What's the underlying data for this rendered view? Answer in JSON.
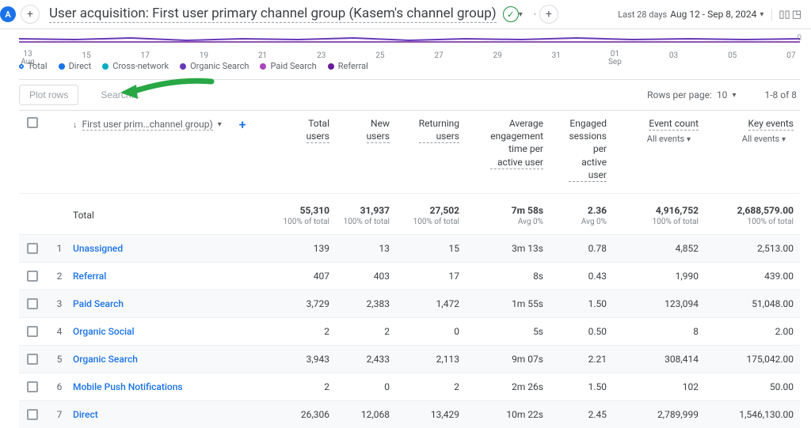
{
  "header": {
    "avatar_letter": "A",
    "add_button_glyph": "+",
    "title": "User acquisition: First user primary channel group (Kasem's channel group)",
    "check_glyph": "✓",
    "add_segment_glyph": "+",
    "date_label": "Last 28 days",
    "date_range": "Aug 12 - Sep 8, 2024"
  },
  "chart_data": {
    "type": "line",
    "ticks": [
      "13",
      "15",
      "17",
      "19",
      "21",
      "23",
      "25",
      "27",
      "29",
      "31",
      "01",
      "03",
      "05",
      "07"
    ],
    "tick_months": {
      "0": "Aug",
      "10": "Sep"
    },
    "ylim": [
      0,
      1000
    ],
    "y_zero_label": "0",
    "series": [
      {
        "name": "Total",
        "color": "#1a73e8",
        "open": true
      },
      {
        "name": "Direct",
        "color": "#1a73e8"
      },
      {
        "name": "Cross-network",
        "color": "#00acc1"
      },
      {
        "name": "Organic Search",
        "color": "#673ab7"
      },
      {
        "name": "Paid Search",
        "color": "#ab47bc"
      },
      {
        "name": "Referral",
        "color": "#6a1b9a"
      }
    ]
  },
  "toolbar": {
    "plot_rows": "Plot rows",
    "search_placeholder": "Search…",
    "rows_per_page_label": "Rows per page:",
    "rows_per_page_value": "10",
    "range_text": "1-8 of 8"
  },
  "columns": {
    "dimension": "First user prim…channel group)",
    "metrics": [
      {
        "label": "Total\nusers"
      },
      {
        "label": "New\nusers"
      },
      {
        "label": "Returning\nusers"
      },
      {
        "label": "Average\nengagement\ntime per\nactive user"
      },
      {
        "label": "Engaged\nsessions\nper\nactive\nuser"
      },
      {
        "label": "Event count",
        "sub": "All events"
      },
      {
        "label": "Key events",
        "sub": "All events"
      }
    ]
  },
  "totals": {
    "label": "Total",
    "values": [
      "55,310",
      "31,937",
      "27,502",
      "7m 58s",
      "2.36",
      "4,916,752",
      "2,688,579.00"
    ],
    "subs": [
      "100% of total",
      "100% of total",
      "100% of total",
      "Avg 0%",
      "Avg 0%",
      "100% of total",
      "100% of total"
    ]
  },
  "rows": [
    {
      "idx": "1",
      "name": "Unassigned",
      "alt": true,
      "v": [
        "139",
        "13",
        "15",
        "3m 13s",
        "0.78",
        "4,852",
        "2,513.00"
      ]
    },
    {
      "idx": "2",
      "name": "Referral",
      "v": [
        "407",
        "403",
        "17",
        "8s",
        "0.43",
        "1,990",
        "439.00"
      ]
    },
    {
      "idx": "3",
      "name": "Paid Search",
      "alt": true,
      "v": [
        "3,729",
        "2,383",
        "1,472",
        "1m 55s",
        "1.50",
        "123,094",
        "51,048.00"
      ]
    },
    {
      "idx": "4",
      "name": "Organic Social",
      "v": [
        "2",
        "2",
        "0",
        "5s",
        "0.50",
        "8",
        "2.00"
      ]
    },
    {
      "idx": "5",
      "name": "Organic Search",
      "alt": true,
      "v": [
        "3,943",
        "2,433",
        "2,113",
        "9m 07s",
        "2.21",
        "308,414",
        "175,042.00"
      ]
    },
    {
      "idx": "6",
      "name": "Mobile Push Notifications",
      "v": [
        "2",
        "0",
        "2",
        "2m 26s",
        "1.50",
        "102",
        "50.00"
      ]
    },
    {
      "idx": "7",
      "name": "Direct",
      "alt": true,
      "v": [
        "26,306",
        "12,068",
        "13,429",
        "10m 22s",
        "2.45",
        "2,789,999",
        "1,546,130.00"
      ]
    }
  ]
}
